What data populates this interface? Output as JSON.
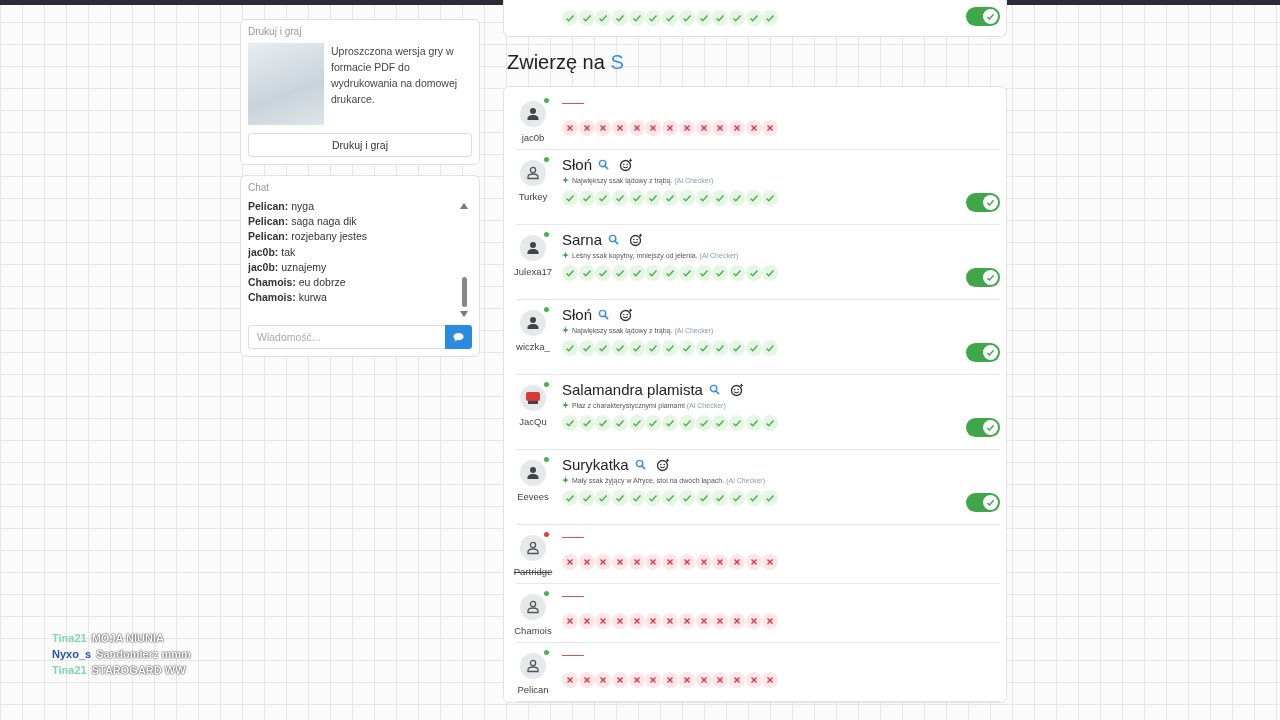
{
  "print_card": {
    "title": "Drukuj i graj",
    "description": "Uproszczona wersja gry w formacie PDF do wydrukowania na domowej drukarce.",
    "button": "Drukuj i graj"
  },
  "chat": {
    "title": "Chat",
    "messages": [
      {
        "user": "Pelican:",
        "text": "nyga"
      },
      {
        "user": "Pelican:",
        "text": "saga naga dik"
      },
      {
        "user": "Pelican:",
        "text": "rozjebany jestes"
      },
      {
        "user": "jac0b:",
        "text": "tak"
      },
      {
        "user": "jac0b:",
        "text": "uznajemy"
      },
      {
        "user": "Chamois:",
        "text": "eu dobrze"
      },
      {
        "user": "Chamois:",
        "text": "kurwa"
      }
    ],
    "placeholder": "Wiadomość..."
  },
  "previous_row": {
    "votes": [
      true,
      true,
      true,
      true,
      true,
      true,
      true,
      true,
      true,
      true,
      true,
      true,
      true
    ],
    "accepted": true
  },
  "category": {
    "title": "Zwierzę na",
    "letter": "S"
  },
  "rows": [
    {
      "player": "jac0b",
      "avatar": {
        "kind": "filled"
      },
      "online": true,
      "kind": "empty",
      "votes": [
        false,
        false,
        false,
        false,
        false,
        false,
        false,
        false,
        false,
        false,
        false,
        false,
        false
      ]
    },
    {
      "player": "Turkey",
      "avatar": {
        "kind": "outline"
      },
      "online": true,
      "kind": "answer",
      "word": "Słoń",
      "hint": "Największy ssak lądowy z trąbą.",
      "checker": "(Ai Checker)",
      "votes": [
        true,
        true,
        true,
        true,
        true,
        true,
        true,
        true,
        true,
        true,
        true,
        true,
        true
      ],
      "accepted": true
    },
    {
      "player": "Julexa17",
      "avatar": {
        "kind": "filled"
      },
      "online": true,
      "kind": "answer",
      "word": "Sarna",
      "hint": "Leśny ssak kopytny, mniejszy od jelenia.",
      "checker": "(Ai Checker)",
      "votes": [
        true,
        true,
        true,
        true,
        true,
        true,
        true,
        true,
        true,
        true,
        true,
        true,
        true
      ],
      "accepted": true
    },
    {
      "player": "wiczka_",
      "avatar": {
        "kind": "filled"
      },
      "online": true,
      "kind": "answer",
      "word": "Słoń",
      "hint": "Największy ssak lądowy z trąbą.",
      "checker": "(Ai Checker)",
      "votes": [
        true,
        true,
        true,
        true,
        true,
        true,
        true,
        true,
        true,
        true,
        true,
        true,
        true
      ],
      "accepted": true
    },
    {
      "player": "JacQu",
      "avatar": {
        "kind": "picture"
      },
      "online": true,
      "kind": "answer",
      "word": "Salamandra plamista",
      "hint": "Płaz z charakterystycznymi plamami",
      "checker": "(Ai Checker)",
      "votes": [
        true,
        true,
        true,
        true,
        true,
        true,
        true,
        true,
        true,
        true,
        true,
        true,
        true
      ],
      "accepted": true
    },
    {
      "player": "Eevees",
      "avatar": {
        "kind": "filled"
      },
      "online": true,
      "kind": "answer",
      "word": "Surykatka",
      "hint": "Mały ssak żyjący w Afryce, stoi na dwóch łapach.",
      "checker": "(Ai Checker)",
      "votes": [
        true,
        true,
        true,
        true,
        true,
        true,
        true,
        true,
        true,
        true,
        true,
        true,
        true
      ],
      "accepted": true
    },
    {
      "player": "Partridge",
      "avatar": {
        "kind": "outline"
      },
      "online": false,
      "kind": "empty",
      "votes": [
        false,
        false,
        false,
        false,
        false,
        false,
        false,
        false,
        false,
        false,
        false,
        false,
        false
      ]
    },
    {
      "player": "Chamois",
      "avatar": {
        "kind": "outline"
      },
      "online": true,
      "kind": "empty",
      "votes": [
        false,
        false,
        false,
        false,
        false,
        false,
        false,
        false,
        false,
        false,
        false,
        false,
        false
      ]
    },
    {
      "player": "Pelican",
      "avatar": {
        "kind": "outline"
      },
      "online": true,
      "kind": "empty",
      "votes": [
        false,
        false,
        false,
        false,
        false,
        false,
        false,
        false,
        false,
        false,
        false,
        false,
        false
      ]
    }
  ],
  "stream_chat": [
    {
      "user": "Tina21",
      "text": "MOJA NIUNIA",
      "color": "#7fd8b0"
    },
    {
      "user": "Nyxo_s",
      "text": "Sandomierz mmm",
      "color": "#2a4fa8"
    },
    {
      "user": "Tina21",
      "text": "STAROGARD WW",
      "color": "#7fd8b0"
    }
  ]
}
